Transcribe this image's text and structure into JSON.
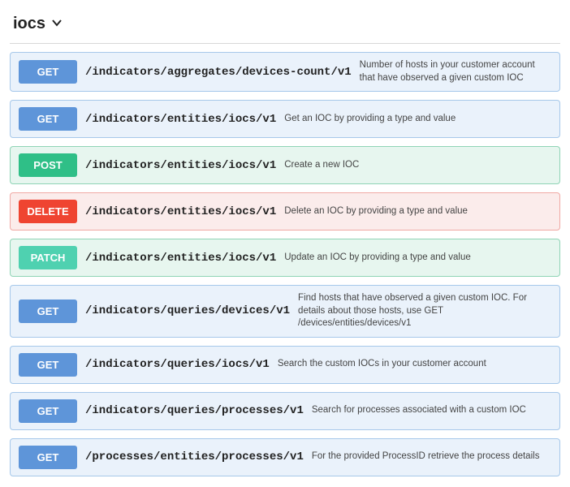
{
  "section": {
    "title": "iocs"
  },
  "endpoints": [
    {
      "method": "GET",
      "path": "/indicators/aggregates/devices-count/v1",
      "desc": "Number of hosts in your customer account that have observed a given custom IOC"
    },
    {
      "method": "GET",
      "path": "/indicators/entities/iocs/v1",
      "desc": "Get an IOC by providing a type and value"
    },
    {
      "method": "POST",
      "path": "/indicators/entities/iocs/v1",
      "desc": "Create a new IOC"
    },
    {
      "method": "DELETE",
      "path": "/indicators/entities/iocs/v1",
      "desc": "Delete an IOC by providing a type and value"
    },
    {
      "method": "PATCH",
      "path": "/indicators/entities/iocs/v1",
      "desc": "Update an IOC by providing a type and value"
    },
    {
      "method": "GET",
      "path": "/indicators/queries/devices/v1",
      "desc": "Find hosts that have observed a given custom IOC. For details about those hosts, use GET /devices/entities/devices/v1"
    },
    {
      "method": "GET",
      "path": "/indicators/queries/iocs/v1",
      "desc": "Search the custom IOCs in your customer account"
    },
    {
      "method": "GET",
      "path": "/indicators/queries/processes/v1",
      "desc": "Search for processes associated with a custom IOC"
    },
    {
      "method": "GET",
      "path": "/processes/entities/processes/v1",
      "desc": "For the provided ProcessID retrieve the process details"
    }
  ]
}
